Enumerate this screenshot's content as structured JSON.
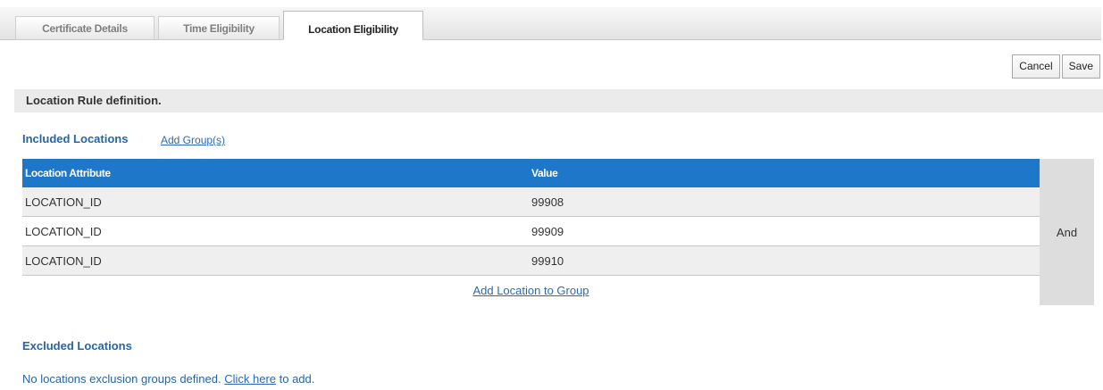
{
  "tabs": [
    {
      "label": "Certificate Details"
    },
    {
      "label": "Time Eligibility"
    },
    {
      "label": "Location Eligibility",
      "active": true
    }
  ],
  "toolbar": {
    "cancel_label": "Cancel",
    "save_label": "Save"
  },
  "section": {
    "title": "Location Rule definition."
  },
  "included": {
    "title": "Included Locations",
    "add_group_link": "Add Group(s)",
    "columns": [
      "Location Attribute",
      "Value"
    ],
    "rows": [
      {
        "attribute": "LOCATION_ID",
        "value": "99908"
      },
      {
        "attribute": "LOCATION_ID",
        "value": "99909"
      },
      {
        "attribute": "LOCATION_ID",
        "value": "99910"
      }
    ],
    "add_location_link": "Add Location to Group",
    "operator": "And"
  },
  "excluded": {
    "title": "Excluded Locations",
    "message_before": "No locations exclusion groups defined. ",
    "link": "Click here",
    "message_after": " to add."
  },
  "colors": {
    "header_blue": "#1f77c9",
    "title_blue": "#2565a6",
    "link_blue": "#2a6ab0"
  }
}
